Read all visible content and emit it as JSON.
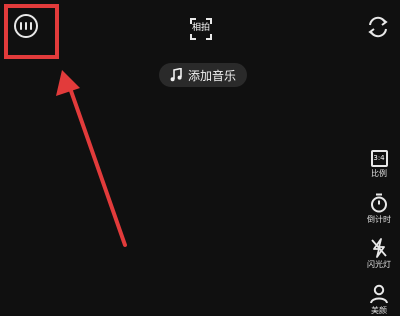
{
  "top_bar": {
    "menu_icon": "more-circle-icon",
    "scan_label": "相拍",
    "flip_icon": "flip-camera-icon"
  },
  "music": {
    "icon": "music-note-icon",
    "label": "添加音乐"
  },
  "side_tools": [
    {
      "icon": "ratio-icon",
      "icon_text": "3:4",
      "label": "比例"
    },
    {
      "icon": "timer-icon",
      "label": "倒计时"
    },
    {
      "icon": "flash-icon",
      "label": "闪光灯"
    },
    {
      "icon": "beauty-icon",
      "label": "美颜"
    }
  ],
  "annotation": {
    "highlight_color": "#e23b3b",
    "arrow_color": "#e23b3b"
  }
}
